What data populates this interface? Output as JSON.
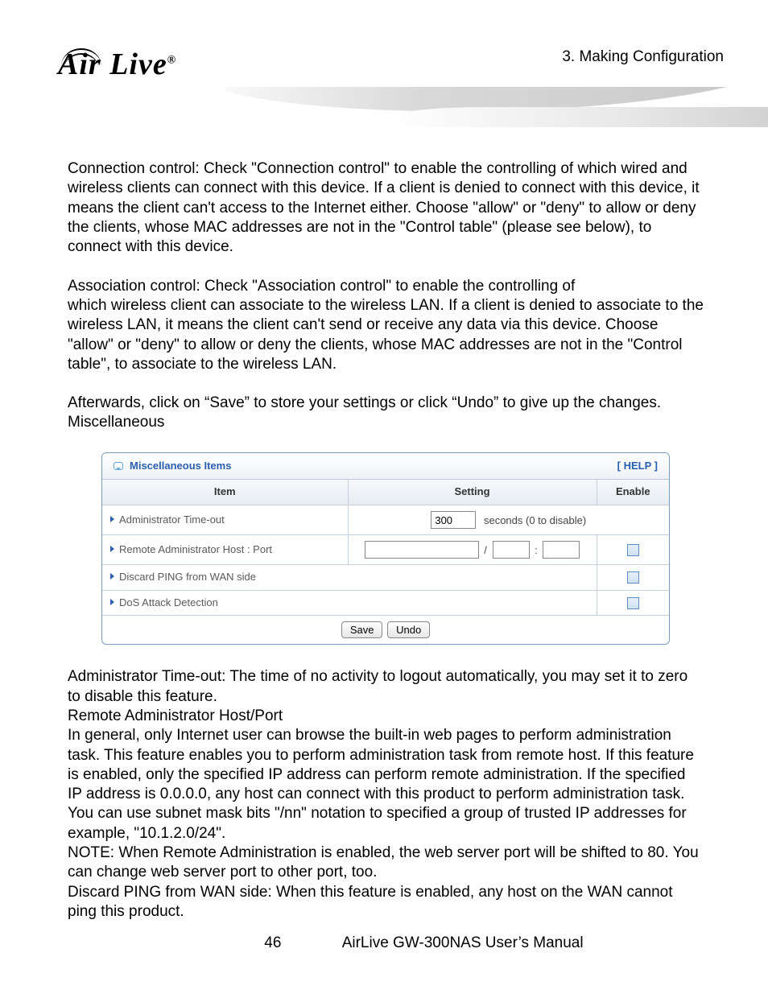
{
  "header": {
    "chapter": "3.  Making  Configuration",
    "logo_text": "Air Live",
    "logo_reg": "®"
  },
  "body": {
    "p1": "Connection control: Check \"Connection control\" to enable the controlling of which wired and wireless clients can connect with this device. If a client is denied to connect with this device, it means the client can't access to the Internet either. Choose \"allow\" or \"deny\" to allow or deny the clients, whose MAC addresses are not in the \"Control table\" (please see below), to connect with this device.",
    "p2a": "Association control: Check \"Association control\" to enable the controlling of",
    "p2b": "which wireless client can associate to the wireless LAN. If a client is denied to associate to the wireless LAN, it means the client can't send or receive any data via this device. Choose \"allow\" or \"deny\" to allow or deny the clients, whose MAC addresses are not in the \"Control table\", to associate to the wireless LAN.",
    "p3a": "Afterwards, click on “Save” to store your settings or click “Undo” to give up the changes.",
    "p3b": "Miscellaneous",
    "p4a": "Administrator Time-out: The time of no activity to logout automatically, you may set it to zero to disable this feature.",
    "p4b": "Remote Administrator Host/Port",
    "p4c": "In general, only Internet user can browse the built-in web pages to perform administration task. This feature enables you to perform administration task from remote host. If this feature is enabled, only the specified IP address can perform remote administration. If the specified IP address is 0.0.0.0, any host can connect with this product to perform administration task. You can use subnet mask bits \"/nn\" notation to specified a group of trusted IP addresses for example, \"10.1.2.0/24\".",
    "p4d": "NOTE: When Remote Administration is enabled, the web server port will be shifted to 80. You can change web server port to other port, too.",
    "p4e": "Discard PING from WAN side: When this feature is enabled, any host on the WAN cannot ping this product."
  },
  "panel": {
    "title": "Miscellaneous Items",
    "help": "[ HELP ]",
    "headers": {
      "item": "Item",
      "setting": "Setting",
      "enable": "Enable"
    },
    "rows": {
      "timeout": {
        "label": "Administrator Time-out",
        "value": "300",
        "suffix": "seconds (0 to disable)"
      },
      "remote": {
        "label": "Remote Administrator Host : Port",
        "host": "",
        "mask": "",
        "port": "",
        "sep1": "/",
        "sep2": ":"
      },
      "ping": {
        "label": "Discard PING from WAN side"
      },
      "dos": {
        "label": "DoS Attack Detection"
      }
    },
    "buttons": {
      "save": "Save",
      "undo": "Undo"
    }
  },
  "footer": {
    "page": "46",
    "title": "AirLive GW-300NAS User’s Manual"
  }
}
